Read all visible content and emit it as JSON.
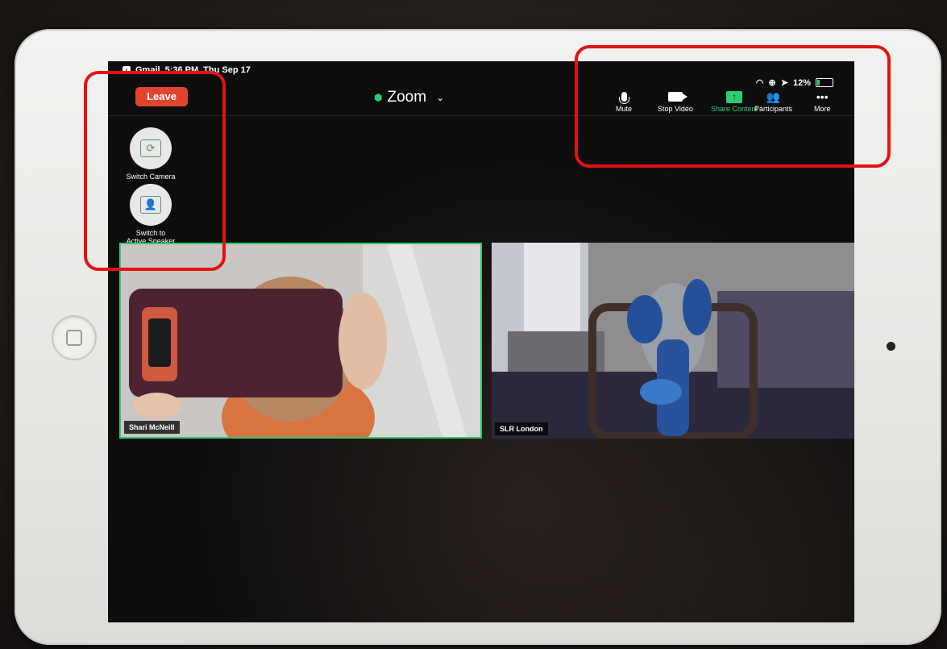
{
  "status_bar": {
    "app": "Gmail",
    "time": "5:36 PM",
    "date": "Thu Sep 17",
    "battery": "12%"
  },
  "meeting": {
    "leave_label": "Leave",
    "title": "Zoom",
    "accent_green": "#2ecc71",
    "leave_color": "#e0452f"
  },
  "toolbar": {
    "mute": "Mute",
    "stop_video": "Stop Video",
    "share_content": "Share Content",
    "participants": "Participants",
    "more": "More"
  },
  "side_controls": {
    "switch_camera": "Switch Camera",
    "switch_active_line1": "Switch to",
    "switch_active_line2": "Active Speaker"
  },
  "participants": [
    {
      "name": "Shari McNeill",
      "active": true
    },
    {
      "name": "SLR London",
      "active": false
    }
  ],
  "annotation_color": "#e31212"
}
